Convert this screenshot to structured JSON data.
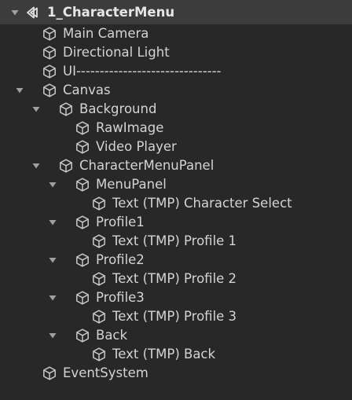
{
  "hierarchy": {
    "scene": {
      "name": "1_CharacterMenu",
      "icon": "unity-scene-icon",
      "expanded": true
    },
    "items": [
      {
        "label": "Main Camera",
        "depth": 1,
        "foldout": "none"
      },
      {
        "label": "Directional Light",
        "depth": 1,
        "foldout": "none"
      },
      {
        "label": "UI-------------------------------",
        "depth": 1,
        "foldout": "none"
      },
      {
        "label": "Canvas",
        "depth": 1,
        "foldout": "expanded"
      },
      {
        "label": "Background",
        "depth": 2,
        "foldout": "expanded"
      },
      {
        "label": "RawImage",
        "depth": 3,
        "foldout": "none"
      },
      {
        "label": "Video Player",
        "depth": 3,
        "foldout": "none"
      },
      {
        "label": "CharacterMenuPanel",
        "depth": 2,
        "foldout": "expanded"
      },
      {
        "label": "MenuPanel",
        "depth": 3,
        "foldout": "expanded"
      },
      {
        "label": "Text (TMP) Character Select",
        "depth": 4,
        "foldout": "none"
      },
      {
        "label": "Profile1",
        "depth": 3,
        "foldout": "expanded"
      },
      {
        "label": "Text (TMP) Profile 1",
        "depth": 4,
        "foldout": "none"
      },
      {
        "label": "Profile2",
        "depth": 3,
        "foldout": "expanded"
      },
      {
        "label": "Text (TMP) Profile 2",
        "depth": 4,
        "foldout": "none"
      },
      {
        "label": "Profile3",
        "depth": 3,
        "foldout": "expanded"
      },
      {
        "label": "Text (TMP) Profile 3",
        "depth": 4,
        "foldout": "none"
      },
      {
        "label": "Back",
        "depth": 3,
        "foldout": "expanded"
      },
      {
        "label": "Text (TMP) Back",
        "depth": 4,
        "foldout": "none"
      },
      {
        "label": "EventSystem",
        "depth": 1,
        "foldout": "none"
      }
    ],
    "item_icon": "gameobject-cube-icon"
  },
  "colors": {
    "background": "#282828",
    "scene_row": "#3c3c3c",
    "text": "#d4d4d4",
    "icon": "#c8c8c8",
    "foldout": "#a0a0a0"
  }
}
